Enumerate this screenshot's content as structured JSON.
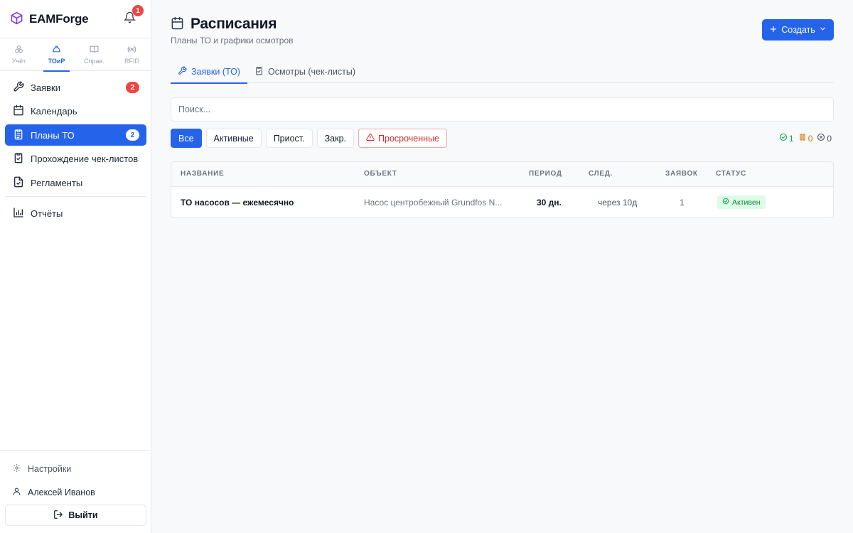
{
  "app": {
    "name": "EAMForge",
    "notifications": "1"
  },
  "modules": [
    {
      "label": "Учёт",
      "icon": "boxes-icon"
    },
    {
      "label": "ТОиР",
      "icon": "helmet-icon",
      "active": true
    },
    {
      "label": "Справ.",
      "icon": "book-icon"
    },
    {
      "label": "RFID",
      "icon": "rfid-icon"
    }
  ],
  "nav": {
    "requests": {
      "label": "Заявки",
      "badge": "2"
    },
    "calendar": {
      "label": "Календарь"
    },
    "plans": {
      "label": "Планы ТО",
      "badge": "2"
    },
    "checklists": {
      "label": "Прохождение чек-листов"
    },
    "regulations": {
      "label": "Регламенты"
    },
    "reports": {
      "label": "Отчёты"
    }
  },
  "bottom": {
    "settings": "Настройки",
    "user": "Алексей Иванов",
    "logout": "Выйти"
  },
  "page": {
    "title": "Расписания",
    "subtitle": "Планы ТО и графики осмотров",
    "create": "Создать"
  },
  "tabs": {
    "requests": "Заявки (ТО)",
    "inspections": "Осмотры (чек-листы)"
  },
  "search": {
    "placeholder": "Поиск..."
  },
  "filters": {
    "all": "Все",
    "active": "Активные",
    "paused": "Приост.",
    "closed": "Закр.",
    "overdue": "Просроченные"
  },
  "counts": {
    "active": "1",
    "paused": "0",
    "closed": "0"
  },
  "table": {
    "headers": {
      "name": "НАЗВАНИЕ",
      "object": "ОБЪЕКТ",
      "period": "ПЕРИОД",
      "next": "СЛЕД.",
      "requests": "ЗАЯВОК",
      "status": "СТАТУС"
    },
    "rows": [
      {
        "name": "ТО насосов — ежемесячно",
        "object": "Насос центробежный Grundfos N...",
        "period": "30 дн.",
        "next": "через 10д",
        "requests": "1",
        "status": "Активен"
      }
    ]
  },
  "colors": {
    "accent": "#2563eb",
    "danger": "#ef4444",
    "success": "#16a34a",
    "warning": "#d97706"
  }
}
